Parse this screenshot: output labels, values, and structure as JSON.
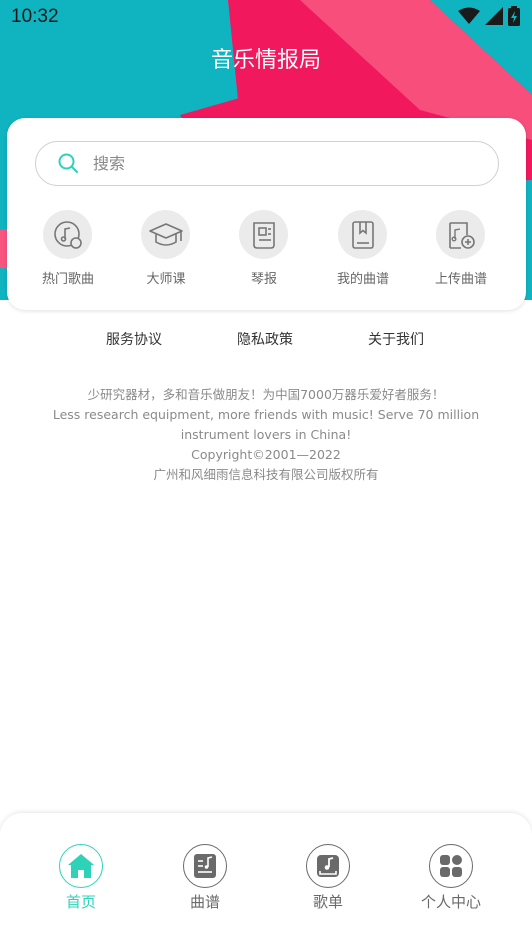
{
  "status_bar": {
    "time": "10:32"
  },
  "header": {
    "title": "音乐情报局"
  },
  "search": {
    "placeholder": "搜索"
  },
  "quick_actions": [
    {
      "label": "热门歌曲",
      "icon": "music-disc-icon"
    },
    {
      "label": "大师课",
      "icon": "graduation-cap-icon"
    },
    {
      "label": "琴报",
      "icon": "newspaper-icon"
    },
    {
      "label": "我的曲谱",
      "icon": "book-icon"
    },
    {
      "label": "上传曲谱",
      "icon": "upload-score-icon"
    }
  ],
  "links": {
    "terms": "服务协议",
    "privacy": "隐私政策",
    "about": "关于我们"
  },
  "footer": {
    "slogan_cn": "少研究器材，多和音乐做朋友！为中国7000万器乐爱好者服务！",
    "slogan_en_1": "Less research equipment, more friends with music! Serve 70 million",
    "slogan_en_2": "instrument lovers in China!",
    "copyright": "Copyright©2001—2022",
    "company": "广州和风细雨信息科技有限公司版权所有"
  },
  "bottom_nav": [
    {
      "label": "首页",
      "icon": "home-icon",
      "active": true
    },
    {
      "label": "曲谱",
      "icon": "music-sheet-icon",
      "active": false
    },
    {
      "label": "歌单",
      "icon": "playlist-icon",
      "active": false
    },
    {
      "label": "个人中心",
      "icon": "profile-center-icon",
      "active": false
    }
  ],
  "colors": {
    "accent": "#2ed3b7",
    "header_teal": "#10b4c1",
    "header_pink": "#f2185e"
  }
}
